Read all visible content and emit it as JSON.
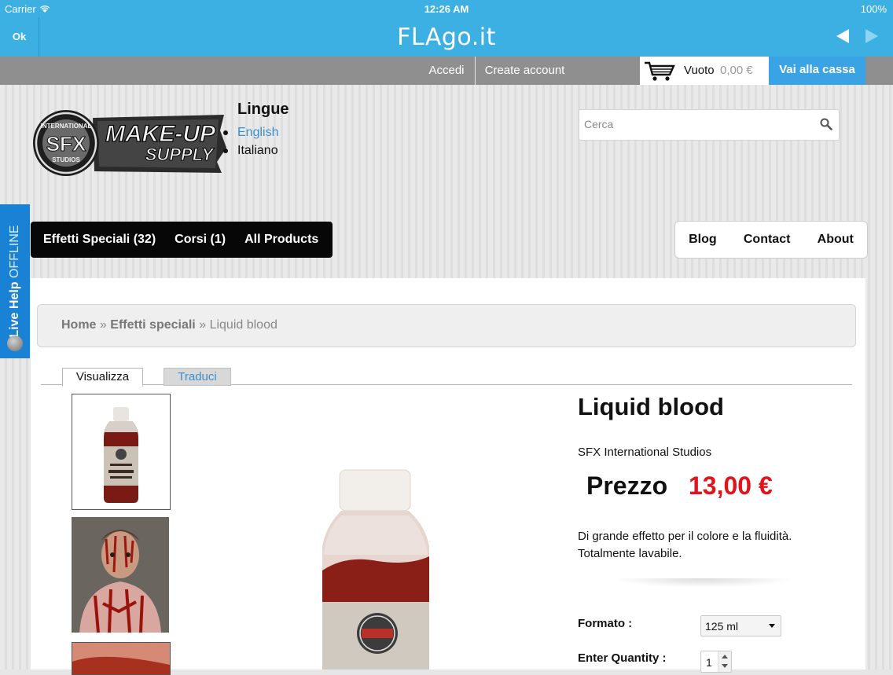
{
  "status_bar": {
    "carrier": "Carrier",
    "time": "12:26 AM",
    "battery": "100%"
  },
  "nav": {
    "ok_label": "Ok",
    "title": "FLAgo.it",
    "back_icon": "back-arrow-icon",
    "forward_icon": "forward-arrow-icon"
  },
  "account_bar": {
    "login": "Accedi",
    "create_account": "Create account",
    "cart_status": "Vuoto",
    "cart_amount": "0,00 €",
    "checkout": "Vai alla cassa"
  },
  "logo": {
    "top_text": "INTERNATIONAL",
    "sfx": "SFX",
    "studios": "STUDIOS",
    "line1": "MAKE-UP",
    "line2": "SUPPLY"
  },
  "languages": {
    "heading": "Lingue",
    "items": [
      "English",
      "Italiano"
    ]
  },
  "search": {
    "placeholder": "Cerca"
  },
  "menu_left": [
    "Effetti Speciali (32)",
    "Corsi (1)",
    "All Products"
  ],
  "menu_right": [
    "Blog",
    "Contact",
    "About"
  ],
  "live_help": {
    "label": "Live Help",
    "status": "OFFLINE"
  },
  "breadcrumb": {
    "home": "Home",
    "sep1": "»",
    "category": "Effetti speciali",
    "sep2": "»",
    "current": "Liquid blood"
  },
  "tabs": [
    "Visualizza",
    "Traduci"
  ],
  "product": {
    "name": "Liquid blood",
    "brand": "SFX International Studios",
    "price_label": "Prezzo",
    "price": "13,00 €",
    "description": "Di grande effetto per il colore e la fluidità. Totalmente lavabile.",
    "format_label": "Formato :",
    "format_value": "125 ml",
    "quantity_label": "Enter Quantity :",
    "quantity_value": "1"
  },
  "colors": {
    "brand_blue": "#3db0e3",
    "price_red": "#e0141d",
    "checkout_blue": "#3aa3e6",
    "live_help_blue": "#1a82d4"
  }
}
